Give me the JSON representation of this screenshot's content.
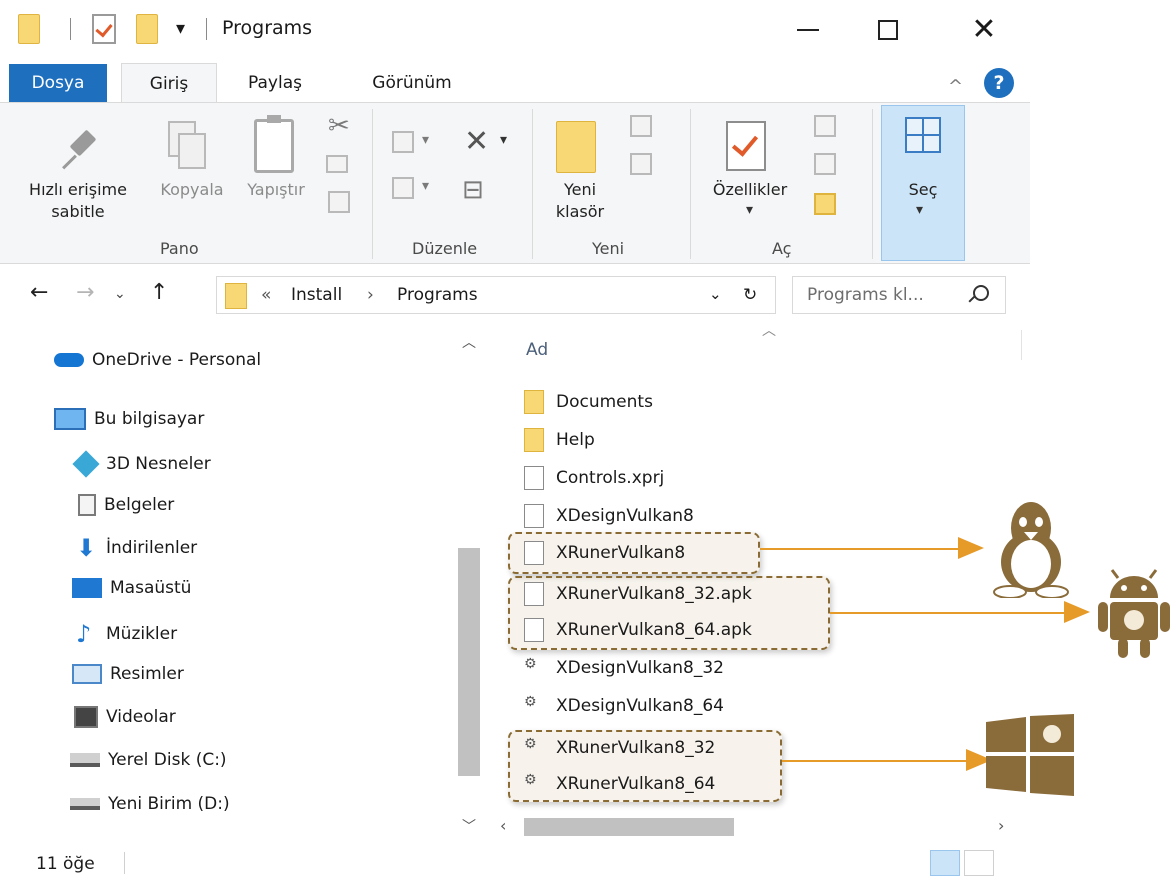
{
  "window": {
    "title": "Programs"
  },
  "ribbon_tabs": [
    "Dosya",
    "Giriş",
    "Paylaş",
    "Görünüm"
  ],
  "ribbon": {
    "pin_line1": "Hızlı erişime",
    "pin_line2": "sabitle",
    "copy": "Kopyala",
    "paste": "Yapıştır",
    "new_folder_line1": "Yeni",
    "new_folder_line2": "klasör",
    "properties": "Özellikler",
    "select": "Seç",
    "groups": [
      "Pano",
      "Düzenle",
      "Yeni",
      "Aç"
    ]
  },
  "address": {
    "chevrons": "«",
    "segments": [
      "Install",
      "Programs"
    ],
    "separator": "›"
  },
  "search": {
    "placeholder": "Programs kl..."
  },
  "nav_pane": {
    "items": [
      {
        "label": "OneDrive - Personal",
        "icon": "onedrive-icon"
      },
      {
        "label": "Bu bilgisayar",
        "icon": "computer-icon"
      },
      {
        "label": "3D Nesneler",
        "icon": "3d-objects-icon"
      },
      {
        "label": "Belgeler",
        "icon": "documents-icon"
      },
      {
        "label": "İndirilenler",
        "icon": "downloads-icon"
      },
      {
        "label": "Masaüstü",
        "icon": "desktop-icon"
      },
      {
        "label": "Müzikler",
        "icon": "music-icon"
      },
      {
        "label": "Resimler",
        "icon": "pictures-icon"
      },
      {
        "label": "Videolar",
        "icon": "videos-icon"
      },
      {
        "label": "Yerel Disk (C:)",
        "icon": "local-disk-icon"
      },
      {
        "label": "Yeni Birim (D:)",
        "icon": "drive-icon"
      }
    ]
  },
  "file_list": {
    "column": "Ad",
    "files": [
      {
        "name": "Documents",
        "type": "folder"
      },
      {
        "name": "Help",
        "type": "folder"
      },
      {
        "name": "Controls.xprj",
        "type": "doc"
      },
      {
        "name": "XDesignVulkan8",
        "type": "doc"
      },
      {
        "name": "XRunerVulkan8",
        "type": "doc"
      },
      {
        "name": "XRunerVulkan8_32.apk",
        "type": "doc"
      },
      {
        "name": "XRunerVulkan8_64.apk",
        "type": "doc"
      },
      {
        "name": "XDesignVulkan8_32",
        "type": "app"
      },
      {
        "name": "XDesignVulkan8_64",
        "type": "app"
      },
      {
        "name": "XRunerVulkan8_32",
        "type": "app"
      },
      {
        "name": "XRunerVulkan8_64",
        "type": "app"
      }
    ]
  },
  "status": {
    "item_count": "11 öğe"
  },
  "annotations": {
    "linux": "linux-logo",
    "android": "android-logo",
    "windows": "windows-logo"
  },
  "colors": {
    "accent": "#1f6fbf",
    "folder": "#f8d775",
    "arrow": "#e69a28",
    "logo": "#8a6b3a"
  }
}
